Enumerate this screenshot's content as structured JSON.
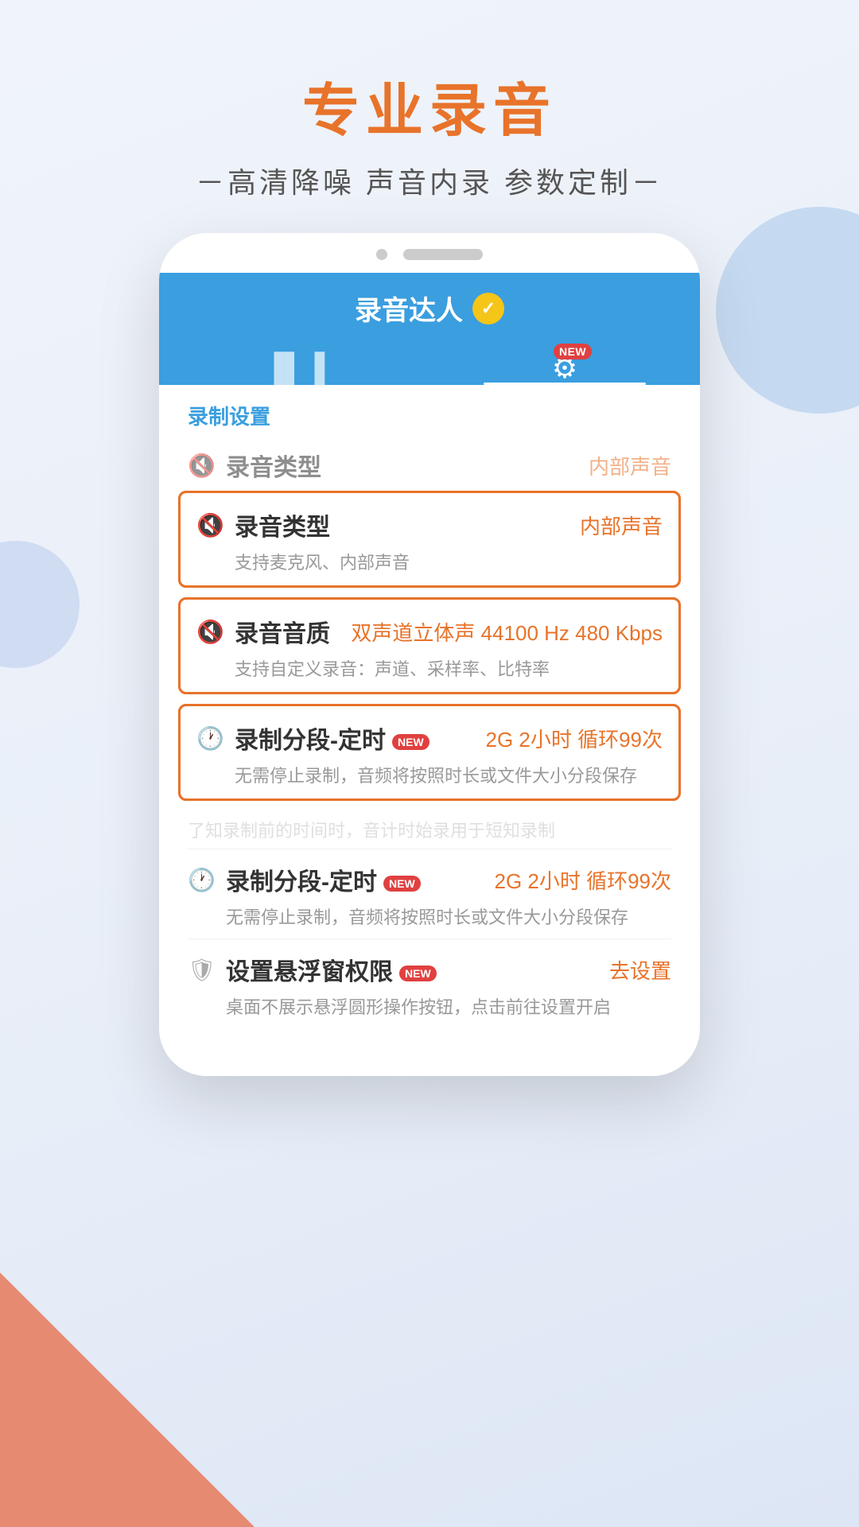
{
  "page": {
    "main_title": "专业录音",
    "subtitle": "－高清降噪 声音内录 参数定制－",
    "bg_color": "#eef2fa"
  },
  "app": {
    "name": "录音达人",
    "tab_waveform_icon": "▌▌▌",
    "tab_settings_icon": "⚙",
    "tab_settings_new": "NEW",
    "settings_section_label": "录制设置"
  },
  "items": [
    {
      "id": "recording_type_dim",
      "icon": "🔇",
      "title": "录音类型",
      "value": "内部声音",
      "desc": "",
      "highlighted": false,
      "dimmed": true
    },
    {
      "id": "recording_type",
      "icon": "🔇",
      "title": "录音类型",
      "value": "内部声音",
      "desc": "支持麦克风、内部声音",
      "highlighted": true,
      "dimmed": false
    },
    {
      "id": "recording_quality",
      "icon": "🔇",
      "title": "录音音质",
      "value": "双声道立体声 44100 Hz 480 Kbps",
      "desc": "支持自定义录音：声道、采样率、比特率",
      "highlighted": true,
      "dimmed": false
    },
    {
      "id": "recording_segment",
      "icon": "🕐",
      "title": "录制分段-定时",
      "new_badge": "NEW",
      "value": "2G 2小时 循环99次",
      "desc": "无需停止录制，音频将按照时长或文件大小分段保存",
      "highlighted": true,
      "dimmed": false
    },
    {
      "id": "recording_segment_dim",
      "icon": "🕐",
      "title": "录制分段-定时",
      "new_badge": "NEW",
      "value": "2G 2小时 循环99次",
      "desc": "无需停止录制，音频将按照时长或文件大小分段保存",
      "highlighted": false,
      "dimmed": false
    },
    {
      "id": "float_permission",
      "icon": "🛡",
      "title": "设置悬浮窗权限",
      "new_badge": "NEW",
      "value": "去设置",
      "desc": "桌面不展示悬浮圆形操作按钮，点击前往设置开启",
      "highlighted": false,
      "dimmed": false
    }
  ]
}
